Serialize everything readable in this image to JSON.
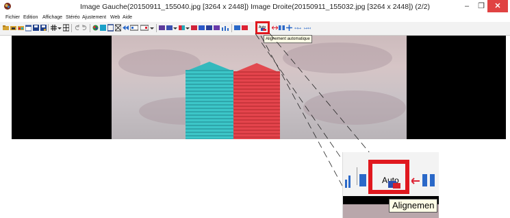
{
  "window": {
    "title": "Image Gauche(20150911_155040.jpg [3264 x 2448]) Image Droite(20150911_155032.jpg [3264 x 2448])  (2/2)",
    "minimize_label": "–",
    "maximize_label": "❐",
    "close_label": "✕"
  },
  "menu": {
    "items": [
      "Fichier",
      "Edition",
      "Affichage",
      "Stéréo",
      "Ajustement",
      "Web",
      "Aide"
    ]
  },
  "tooltip": {
    "small_text": "Alignement automatique",
    "zoom_text": "Alignemen"
  },
  "zoom": {
    "auto_label": "Auto"
  },
  "colors": {
    "highlight": "#e0181e",
    "close_button": "#e04343",
    "anaglyph_cyan": "#3cc6c8",
    "anaglyph_red": "#e4444c"
  },
  "icons": [
    "app-logo-icon",
    "open-folder-icon",
    "open-folder-alt-icon",
    "open-folder-pair-icon",
    "window-icon",
    "save-icon",
    "save-as-icon",
    "grid-icon",
    "grid-options-icon",
    "rotate-left-icon",
    "rotate-right-icon",
    "color-wheel-icon",
    "stereo-mode-icons",
    "auto-align-icon",
    "chart-icon",
    "move-icon",
    "arrows-h-icon"
  ]
}
